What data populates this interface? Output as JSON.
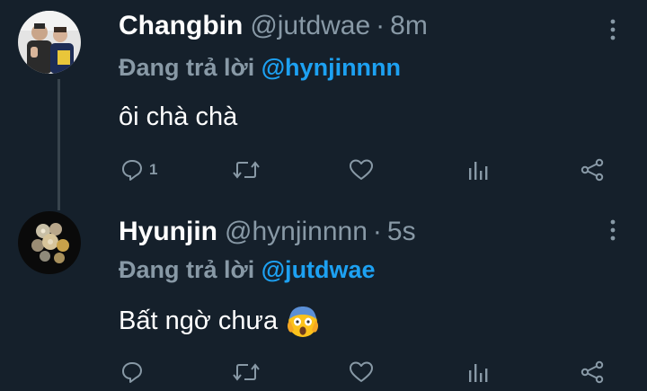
{
  "tweets": [
    {
      "name": "Changbin",
      "handle": "@jutdwae",
      "separator": "·",
      "time": "8m",
      "reply_prefix": "Đang trả lời",
      "reply_to": "@hynjinnnn",
      "text": "ôi chà chà",
      "reply_count": "1",
      "actions": [
        "reply-icon",
        "retweet-icon",
        "like-icon",
        "analytics-icon",
        "share-icon"
      ]
    },
    {
      "name": "Hyunjin",
      "handle": "@hynjinnnn",
      "separator": "·",
      "time": "5s",
      "reply_prefix": "Đang trả lời",
      "reply_to": "@jutdwae",
      "text": "Bất ngờ chưa",
      "emoji": "face-screaming-in-fear",
      "reply_count": "",
      "actions": [
        "reply-icon",
        "retweet-icon",
        "like-icon",
        "analytics-icon",
        "share-icon"
      ]
    }
  ],
  "colors": {
    "background": "#15202b",
    "secondary_text": "#8899a6",
    "mention": "#1da1f2",
    "thread_line": "#38444d"
  }
}
